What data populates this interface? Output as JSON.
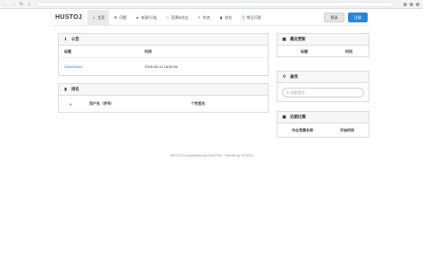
{
  "browser": {
    "icons": [
      "back-icon",
      "forward-icon",
      "reload-icon",
      "home-icon"
    ]
  },
  "navbar": {
    "brand": "HUSTOJ",
    "items": [
      {
        "label": "主页",
        "icon": "home-icon",
        "active": true
      },
      {
        "label": "问题",
        "icon": "list-icon"
      },
      {
        "label": "来源/分类",
        "icon": "globe-icon"
      },
      {
        "label": "竞赛&作业",
        "icon": "trophy-icon"
      },
      {
        "label": "状态",
        "icon": "status-list-icon"
      },
      {
        "label": "排名",
        "icon": "signal-icon"
      },
      {
        "label": "常见问答",
        "icon": "question-icon"
      }
    ],
    "login": "登录",
    "register": "注册"
  },
  "notice": {
    "title": "公告",
    "icon": "info-icon",
    "headers": [
      "标题",
      "时间"
    ],
    "rows": [
      {
        "title": "HelloWorld!",
        "time": "2009-06-13 18:00:00"
      }
    ]
  },
  "ranking": {
    "title": "排名",
    "icon": "bar-chart-icon",
    "headers": [
      "#",
      "用户名（学号）",
      "个性签名"
    ]
  },
  "recent_updates": {
    "title": "最近更新",
    "icon": "rss-icon",
    "headers": [
      "标题",
      "时间"
    ]
  },
  "search": {
    "title": "查找",
    "icon": "search-icon",
    "placeholder": "搜索题号..."
  },
  "recent_contests": {
    "title": "近期比赛",
    "icon": "calendar-icon",
    "headers": [
      "作业竞赛名称",
      "开始时间"
    ]
  },
  "footer": "HUSTOJ is powered by HUSTOJ. Theme by SYZOJ"
}
